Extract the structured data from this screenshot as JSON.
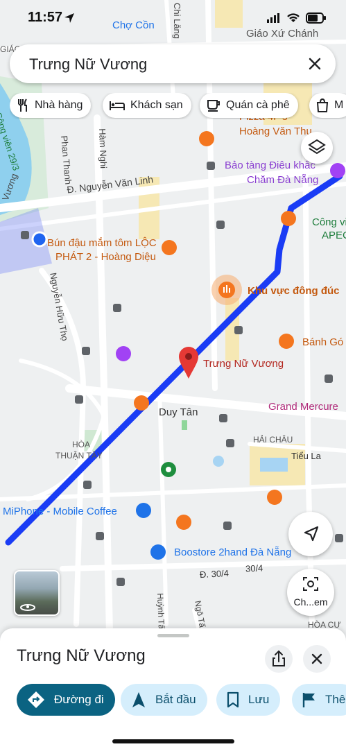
{
  "status": {
    "time": "11:57"
  },
  "search": {
    "query": "Trưng Nữ Vương"
  },
  "chips": [
    {
      "label": "Nhà hàng",
      "icon": "restaurant-icon"
    },
    {
      "label": "Khách sạn",
      "icon": "hotel-icon"
    },
    {
      "label": "Quán cà phê",
      "icon": "coffee-icon"
    },
    {
      "label": "M",
      "icon": "shopping-icon"
    }
  ],
  "map": {
    "labels": {
      "cho_con": "Chợ Cồn",
      "chi_lang": "Chi Lăng",
      "giao_xu": "Giáo Xứ Chánh",
      "giao": "GIÁO",
      "cong_vien": "Công viên 29/3",
      "phan_thanh": "Phan Thanh",
      "ham_nghi": "Hàm Nghi",
      "nguyen_van_linh": "Đ. Nguyễn Văn Linh",
      "pizza": "Pizza 4P's",
      "pizza2": "Hoàng Văn Thụ",
      "bao_tang": "Bảo tàng Điêu khắc",
      "bao_tang2": "Chăm Đà Nẵng",
      "cong_vien_apec": "Công vi",
      "apec": "APEC",
      "bun_dau": "Bún đậu mắm tôm LỘC",
      "bun_dau2": "PHÁT 2 - Hoàng Diệu",
      "khu_vuc": "Khu vực đông đúc",
      "nguyen_huu_tho": "Nguyễn Hữu Thọ",
      "banh_go": "Bánh Gó",
      "pin_label": "Trưng Nữ Vương",
      "duy_tan": "Duy Tân",
      "grand_mercure": "Grand Mercure",
      "hoa_thuan_tay": "HÒA\nTHUẬN TÂY",
      "hai_chau": "HẢI CHÂU",
      "tieu_la": "Tiểu La",
      "miphone": "MiPhone - Mobile Coffee",
      "boostore": "Boostore 2hand Đà Nẵng",
      "d_30_4": "Đ. 30/4",
      "huynh_tan": "Huỳnh Tấ",
      "ngo_tat": "Ngô Tấ",
      "hoa_cu": "HÒA CƯ",
      "vuong": "Vương"
    },
    "compass_label": "Ch...em"
  },
  "sheet": {
    "title": "Trưng Nữ Vương",
    "actions": [
      {
        "label": "Đường đi"
      },
      {
        "label": "Bắt đầu"
      },
      {
        "label": "Lưu"
      },
      {
        "label": "Thê"
      }
    ]
  },
  "colors": {
    "route": "#1a3cf5",
    "pin": "#e53935",
    "accent": "#0b6382",
    "poi_orange": "#f4761f",
    "poi_purple": "#a142f4"
  }
}
